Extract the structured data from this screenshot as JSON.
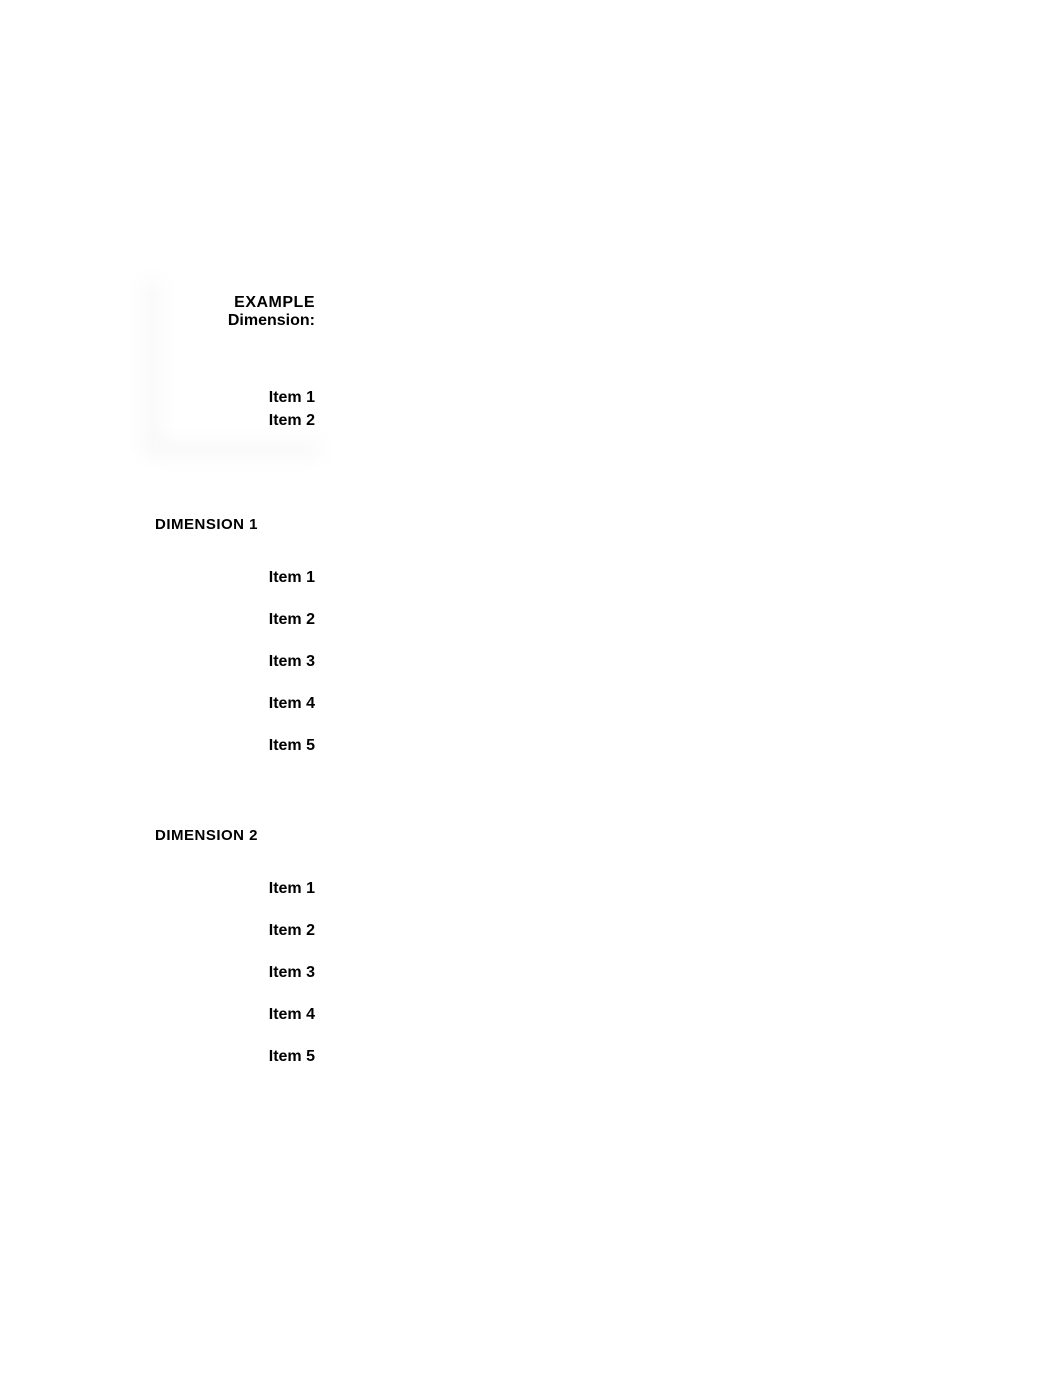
{
  "example": {
    "title": "EXAMPLE",
    "subtitle": "Dimension:",
    "items": [
      "Item 1",
      "Item 2"
    ]
  },
  "sections": [
    {
      "title": "DIMENSION 1",
      "items": [
        "Item 1",
        "Item 2",
        "Item 3",
        "Item 4",
        "Item 5"
      ]
    },
    {
      "title": "DIMENSION 2",
      "items": [
        "Item 1",
        "Item 2",
        "Item 3",
        "Item 4",
        "Item 5"
      ]
    }
  ]
}
